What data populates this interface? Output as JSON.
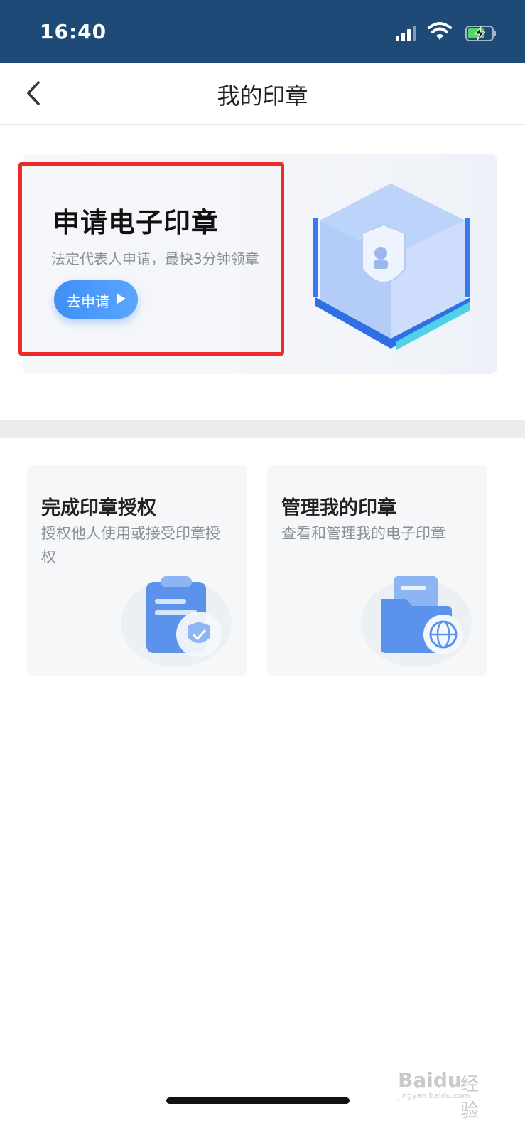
{
  "status_bar": {
    "time": "16:40"
  },
  "nav": {
    "title": "我的印章"
  },
  "banner": {
    "title": "申请电子印章",
    "subtitle": "法定代表人申请，最快3分钟领章",
    "button_label": "去申请"
  },
  "cards": [
    {
      "title": "完成印章授权",
      "description": "授权他人使用或接受印章授权"
    },
    {
      "title": "管理我的印章",
      "description": "查看和管理我的电子印章"
    }
  ],
  "watermark": {
    "brand": "Baidu",
    "suffix": "经验",
    "url": "jingyan.baidu.com"
  },
  "colors": {
    "status_bar": "#1e4a78",
    "accent": "#3e8ff5",
    "highlight": "#ee2b2b"
  }
}
